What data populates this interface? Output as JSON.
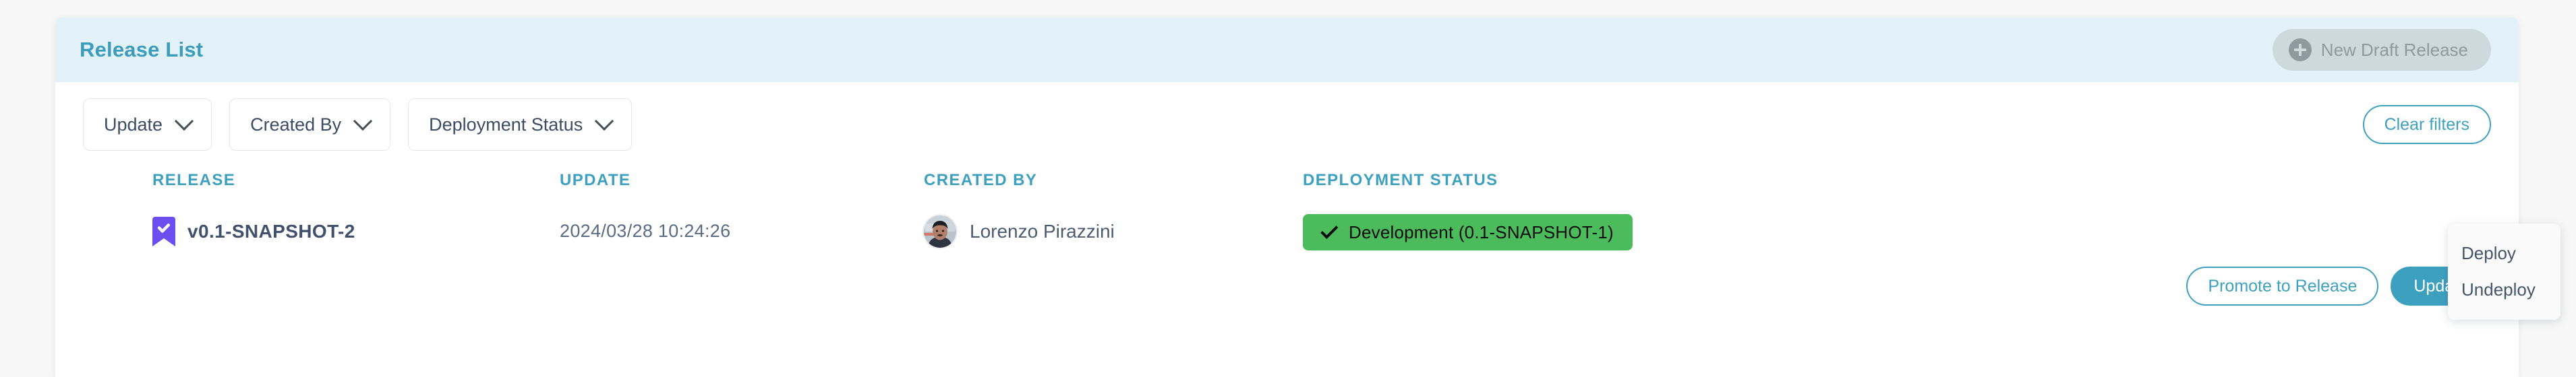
{
  "panel": {
    "title": "Release List",
    "new_draft_label": "New Draft Release",
    "clear_filters_label": "Clear filters"
  },
  "filters": [
    {
      "label": "Update"
    },
    {
      "label": "Created By"
    },
    {
      "label": "Deployment Status"
    }
  ],
  "table": {
    "headers": {
      "release": "RELEASE",
      "update": "UPDATE",
      "created_by": "CREATED BY",
      "deployment_status": "DEPLOYMENT STATUS"
    },
    "rows": [
      {
        "release": "v0.1-SNAPSHOT-2",
        "update": "2024/03/28 10:24:26",
        "created_by": "Lorenzo Pirazzini",
        "status": "Development (0.1-SNAPSHOT-1)",
        "actions": {
          "promote": "Promote to Release",
          "update": "Update"
        }
      }
    ]
  },
  "popup_menu": {
    "items": [
      {
        "label": "Deploy"
      },
      {
        "label": "Undeploy"
      }
    ]
  },
  "colors": {
    "accent_teal": "#3ea0bf",
    "header_band": "#e3f2f8",
    "status_green": "#4cbb5b",
    "bookmark_purple": "#6c4ff0",
    "page_bg": "#f7f7f7"
  }
}
